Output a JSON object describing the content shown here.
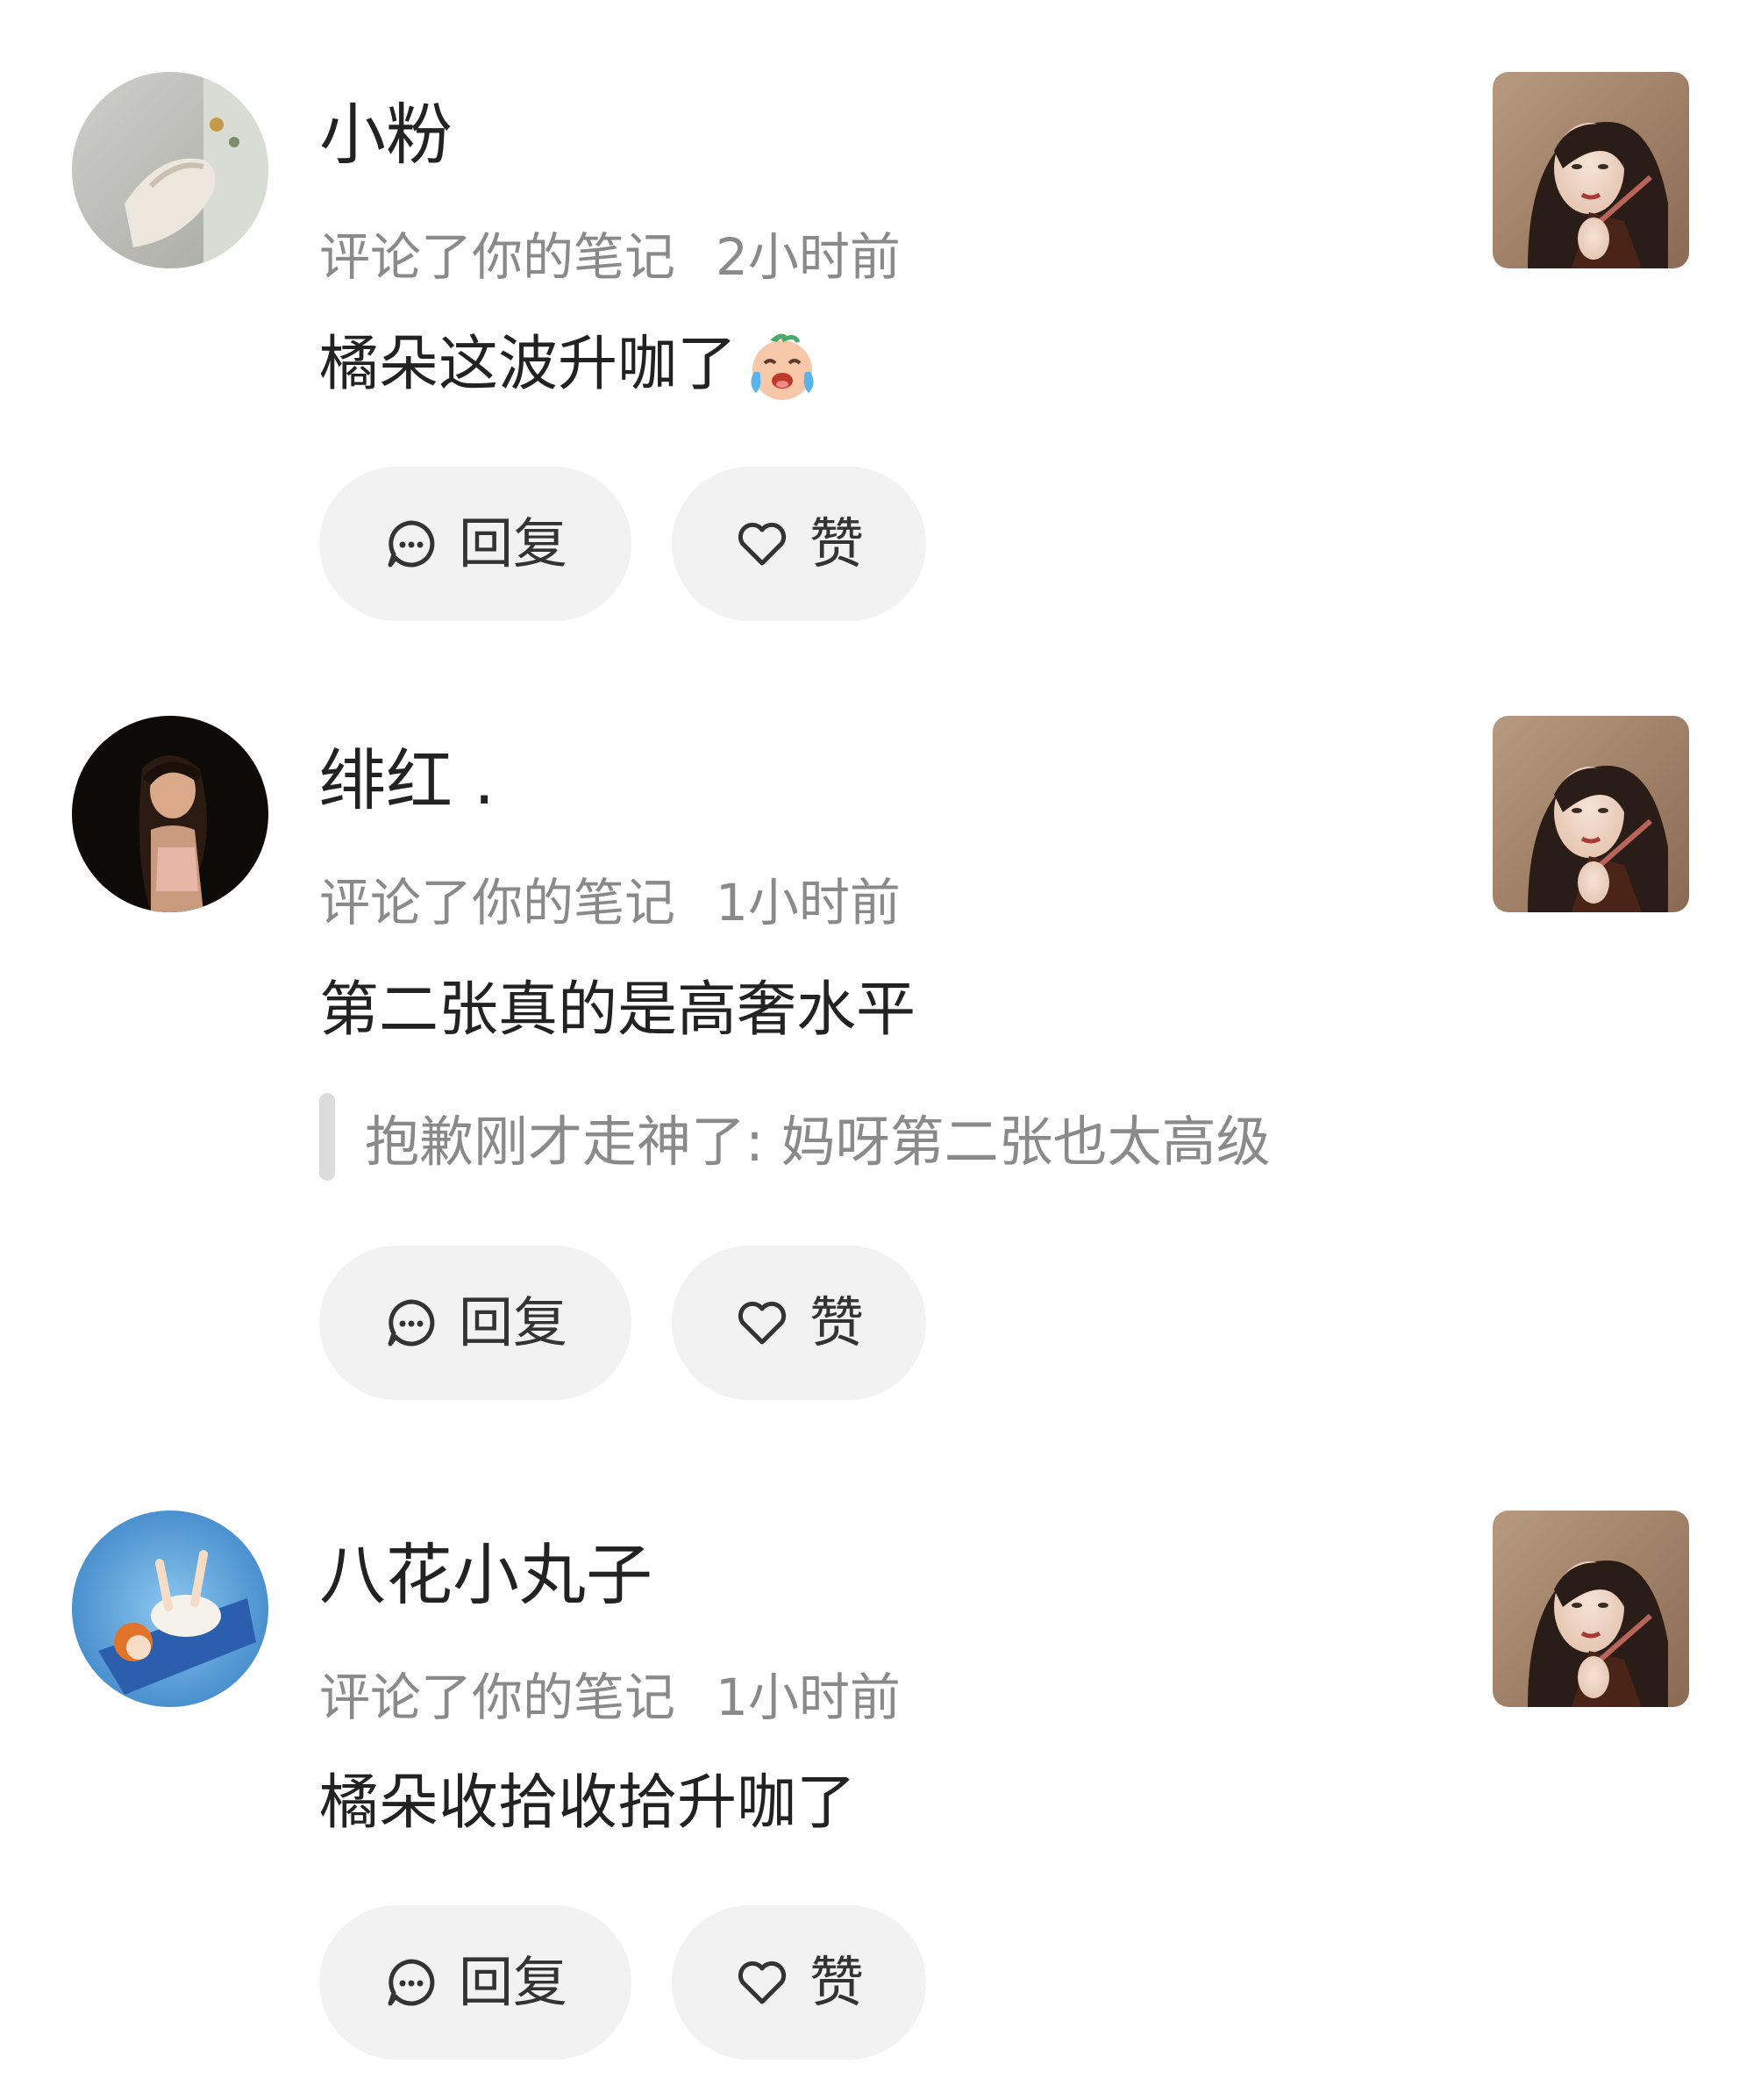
{
  "comments": [
    {
      "username": "小粉",
      "action": "评论了你的笔记",
      "time": "2小时前",
      "text": "橘朵这波升咖了",
      "emoji": "crying-laughing-baby-emoji",
      "reply_label": "回复",
      "like_label": "赞"
    },
    {
      "username": "绯红 .",
      "action": "评论了你的笔记",
      "time": "1小时前",
      "text": "第二张真的是高奢水平",
      "quote": "抱歉刚才走神了: 妈呀第二张也太高级",
      "reply_label": "回复",
      "like_label": "赞"
    },
    {
      "username": "八花小丸子",
      "action": "评论了你的笔记",
      "time": "1小时前",
      "text": "橘朵收拾收拾升咖了",
      "reply_label": "回复",
      "like_label": "赞"
    }
  ],
  "icons": {
    "reply": "chat-bubble-icon",
    "like": "heart-outline-icon"
  }
}
